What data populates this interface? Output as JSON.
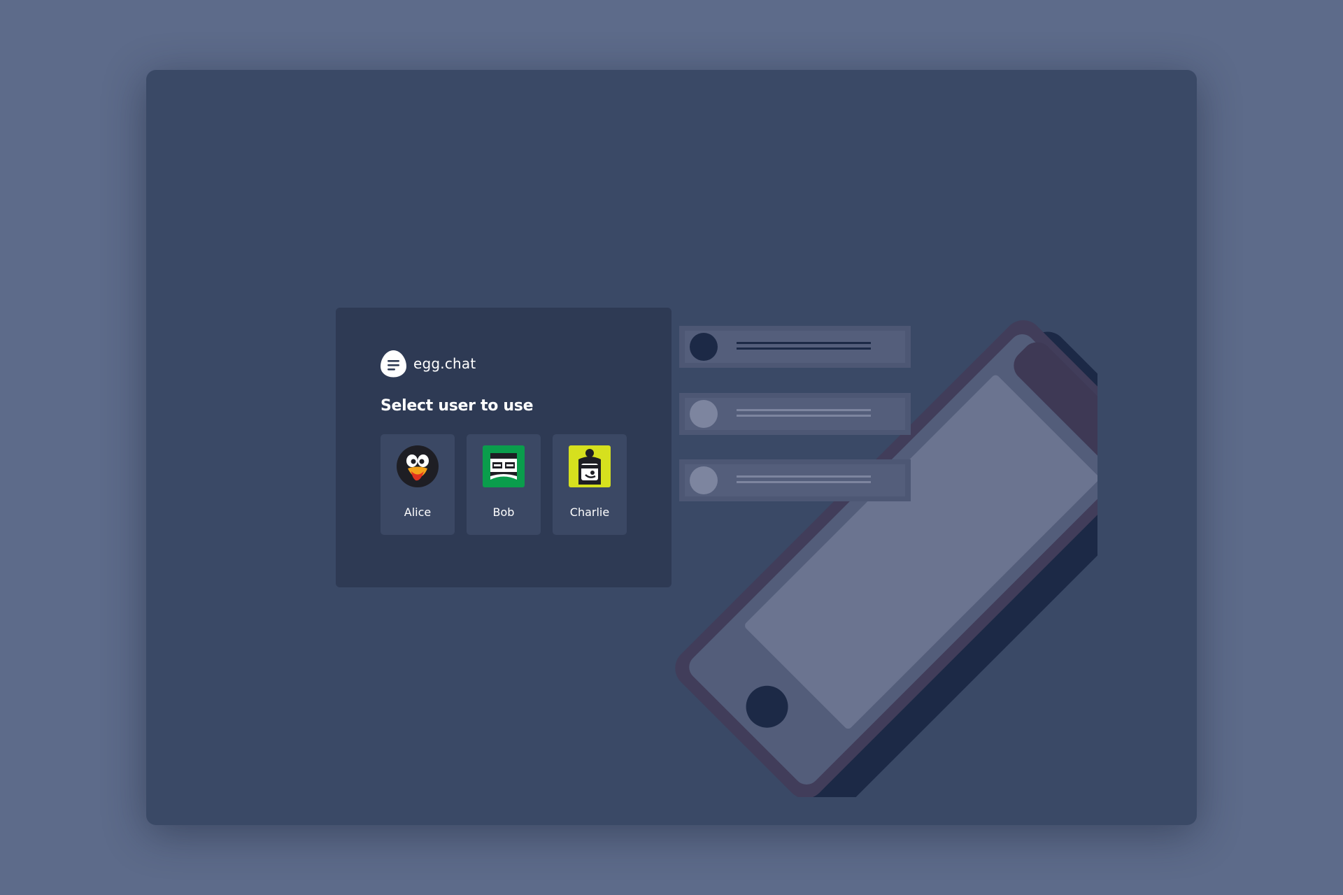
{
  "app": {
    "name": "egg.chat"
  },
  "login": {
    "title": "Select user to use"
  },
  "users": [
    {
      "name": "Alice",
      "avatar": "penguin-avatar-icon",
      "color": "#1e1e24"
    },
    {
      "name": "Bob",
      "avatar": "robot-avatar-icon",
      "color": "#0a9d4c"
    },
    {
      "name": "Charlie",
      "avatar": "ninja-avatar-icon",
      "color": "#d6e01e"
    }
  ],
  "colors": {
    "page_background": "#5d6b8a",
    "window_background": "#3a4966",
    "card_background": "#2e3a54",
    "tile_background": "#3b4864"
  }
}
